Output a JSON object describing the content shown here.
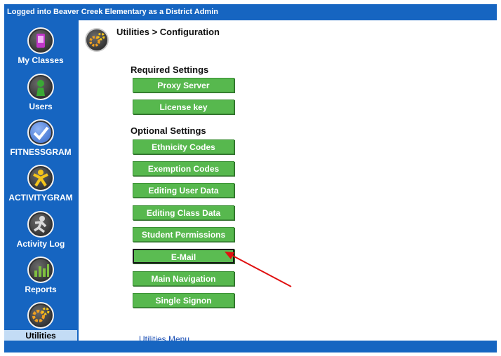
{
  "header": {
    "login_text": "Logged into Beaver Creek Elementary as a District Admin"
  },
  "sidebar": {
    "items": [
      {
        "label": "My Classes",
        "icon": "my-classes-icon",
        "color": "#c036c8"
      },
      {
        "label": "Users",
        "icon": "users-icon",
        "color": "#3aa835"
      },
      {
        "label": "FITNESSGRAM",
        "icon": "fitnessgram-icon",
        "color": "#4a7be0"
      },
      {
        "label": "ACTIVITYGRAM",
        "icon": "activitygram-icon",
        "color": "#f5c51a"
      },
      {
        "label": "Activity Log",
        "icon": "activity-log-icon",
        "color": "#9a9a9a"
      },
      {
        "label": "Reports",
        "icon": "reports-icon",
        "color": "#7fbf3f"
      },
      {
        "label": "Utilities",
        "icon": "utilities-icon",
        "color": "#f0a020"
      }
    ]
  },
  "main": {
    "breadcrumb": "Utilities > Configuration",
    "required_title": "Required Settings",
    "required_buttons": [
      "Proxy Server",
      "License key"
    ],
    "optional_title": "Optional Settings",
    "optional_buttons": [
      "Ethnicity Codes",
      "Exemption Codes",
      "Editing User Data",
      "Editing Class Data",
      "Student Permissions",
      "E-Mail",
      "Main Navigation",
      "Single Signon"
    ],
    "footer_link": "Utilities Menu"
  },
  "colors": {
    "brand_blue": "#1665c1",
    "button_green": "#57b84e",
    "arrow_red": "#e01010"
  }
}
